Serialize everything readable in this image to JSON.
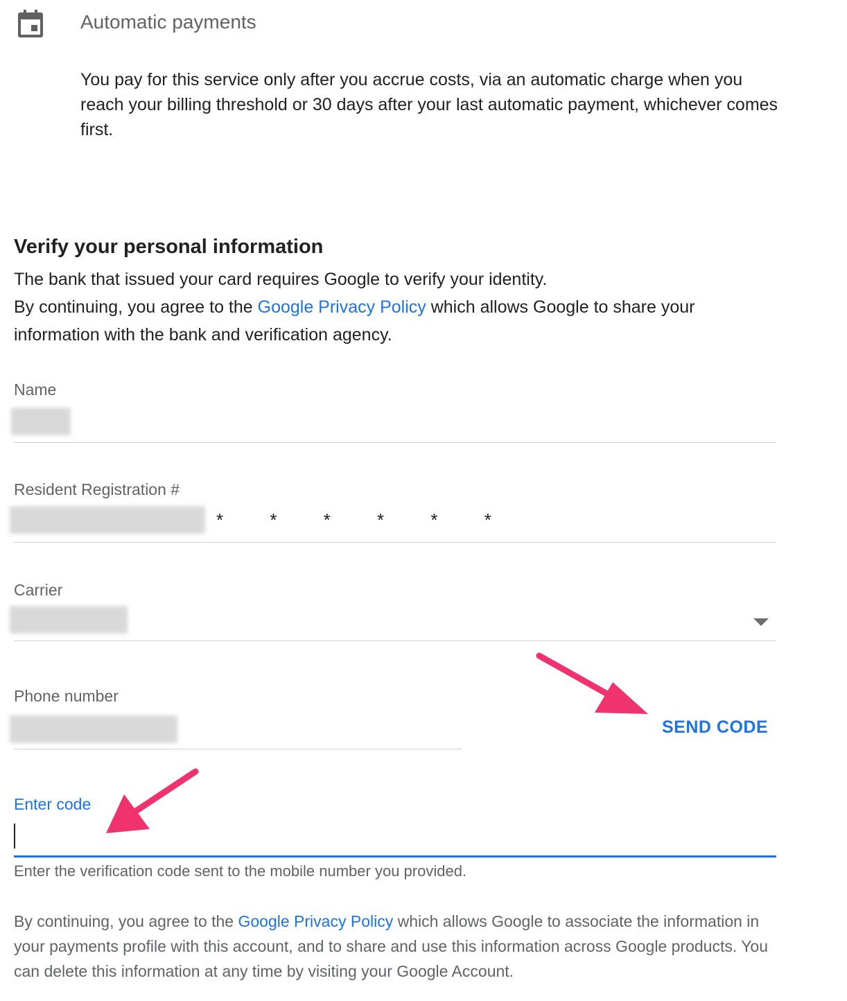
{
  "automatic_payments": {
    "icon": "calendar-icon",
    "title": "Automatic payments",
    "description": "You pay for this service only after you accrue costs, via an automatic charge when you reach your billing threshold or 30 days after your last automatic payment, whichever comes first."
  },
  "verify": {
    "title": "Verify your personal information",
    "line1": "The bank that issued your card requires Google to verify your identity.",
    "line2_prefix": "By continuing, you agree to the ",
    "privacy_link": "Google Privacy Policy",
    "line2_suffix": " which allows Google to share your information with the bank and verification agency."
  },
  "fields": {
    "name_label": "Name",
    "rrn_label": "Resident Registration #",
    "rrn_mask": "* * * * * *",
    "carrier_label": "Carrier",
    "phone_label": "Phone number",
    "send_code_label": "SEND CODE",
    "enter_code_label": "Enter code",
    "enter_code_value": "",
    "enter_code_helper": "Enter the verification code sent to the mobile number you provided."
  },
  "footer": {
    "prefix": "By continuing, you agree to the ",
    "privacy_link": "Google Privacy Policy",
    "suffix": " which allows Google to associate the information in your payments profile with this account, and to share and use this information across Google products. You can delete this information at any time by visiting your Google Account."
  },
  "colors": {
    "accent": "#1a73e8",
    "annotation_arrow": "#f0336f",
    "secondary_text": "#5f6368"
  }
}
